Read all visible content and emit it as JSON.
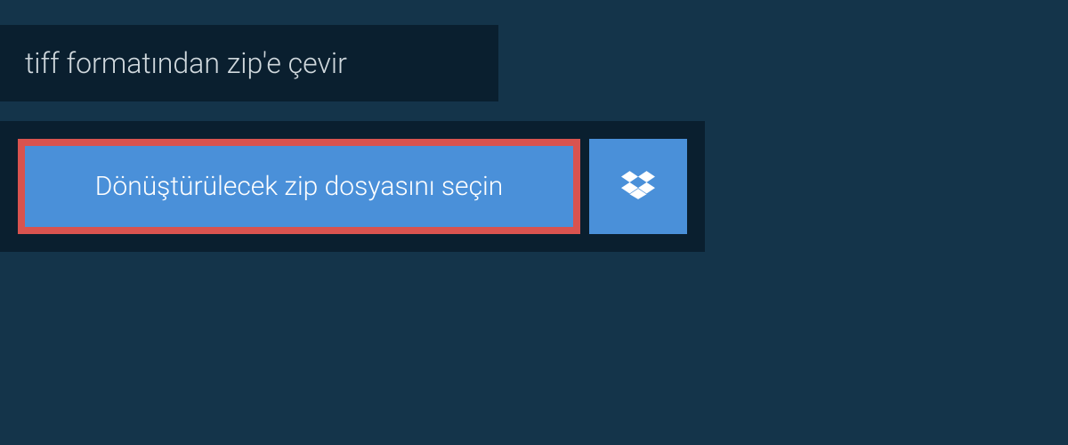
{
  "header": {
    "title": "tiff formatından zip'e çevir"
  },
  "upload": {
    "select_button_label": "Dönüştürülecek zip dosyasını seçin"
  },
  "colors": {
    "page_bg": "#14344a",
    "panel_bg": "#0a1f2f",
    "button_bg": "#4a90d9",
    "button_border": "#d9534f",
    "text_light": "#ffffff",
    "text_muted": "#d0d8dd"
  }
}
